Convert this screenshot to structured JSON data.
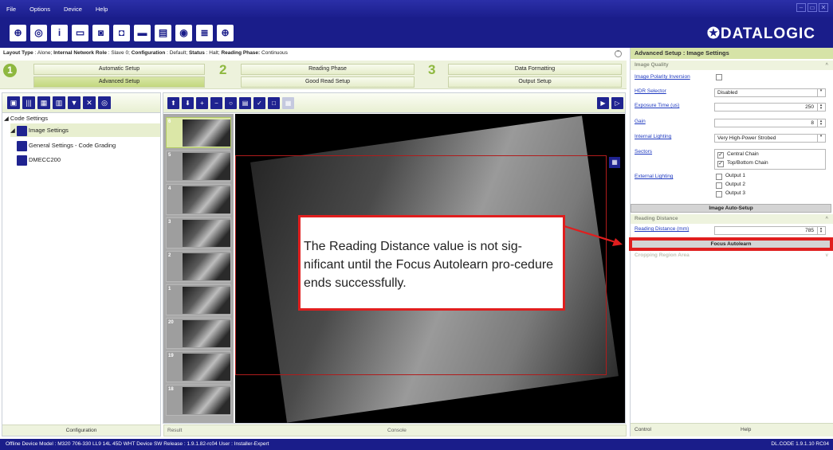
{
  "menu": [
    "File",
    "Options",
    "Device",
    "Help"
  ],
  "window_controls": [
    "–",
    "▭",
    "✕"
  ],
  "logo": "✪DATALOGIC",
  "status_line": {
    "layout_type_label": "Layout Type",
    "layout_type": "Alone",
    "network_role_label": "Internal Network Role",
    "network_role": "Slave 0",
    "configuration_label": "Configuration",
    "configuration": "Default",
    "status_label": "Status",
    "status": "Halt",
    "reading_phase_label": "Reading Phase:",
    "reading_phase": "Continuous"
  },
  "wizard": {
    "step1": "1",
    "step2": "2",
    "step3": "3",
    "automatic_setup": "Automatic Setup",
    "advanced_setup": "Advanced Setup",
    "reading_phase": "Reading Phase",
    "good_read_setup": "Good Read Setup",
    "data_formatting": "Data Formatting",
    "output_setup": "Output Setup"
  },
  "tree": {
    "root": "◢ Code Settings",
    "image_settings": "Image Settings",
    "general_settings": "General Settings - Code Grading",
    "dmecc": "DMECC200"
  },
  "left_footer": "Configuration",
  "thumb_labels": [
    "6",
    "5",
    "4",
    "3",
    "2",
    "1",
    "20",
    "19",
    "18"
  ],
  "center_footer": {
    "result": "Result",
    "console": "Console"
  },
  "right_panel": {
    "title": "Advanced Setup : Image Settings",
    "image_quality": "Image Quality",
    "polarity_label": "Image Polarity Inversion",
    "hdr_label": "HDR Selector",
    "hdr_value": "Disabled",
    "exposure_label": "Exposure Time (us)",
    "exposure_value": "250",
    "gain_label": "Gain",
    "gain_value": "8",
    "lighting_label": "Internal Lighting",
    "lighting_value": "Very High-Power Strobed",
    "sectors_label": "Sectors",
    "sector1": "Central Chain",
    "sector2": "Top/Bottom Chain",
    "ext_lighting_label": "External Lighting",
    "output1": "Output 1",
    "output2": "Output 2",
    "output3": "Output 3",
    "auto_setup": "Image Auto-Setup",
    "reading_distance": "Reading Distance",
    "reading_distance_label": "Reading Distance (mm)",
    "reading_distance_value": "785",
    "focus_autolearn": "Focus Autolearn",
    "cropping": "Cropping Region Area",
    "tab_control": "Control",
    "tab_help": "Help"
  },
  "callout": "The Reading Distance value is not sig-nificant until the Focus Autolearn pro-cedure ends successfully.",
  "statusbar": {
    "left": "Offline Device Model : M320 706-330 LL9 14L 45D WHT  Device SW Release : 1.9.1.82-rc04  User : Installer-Expert",
    "right": "DL.CODE 1.9.1.10 RC04"
  },
  "colors": {
    "brand_blue": "#1a1d8a",
    "accent_green": "#8eb83f",
    "highlight_red": "#e01e1e"
  }
}
